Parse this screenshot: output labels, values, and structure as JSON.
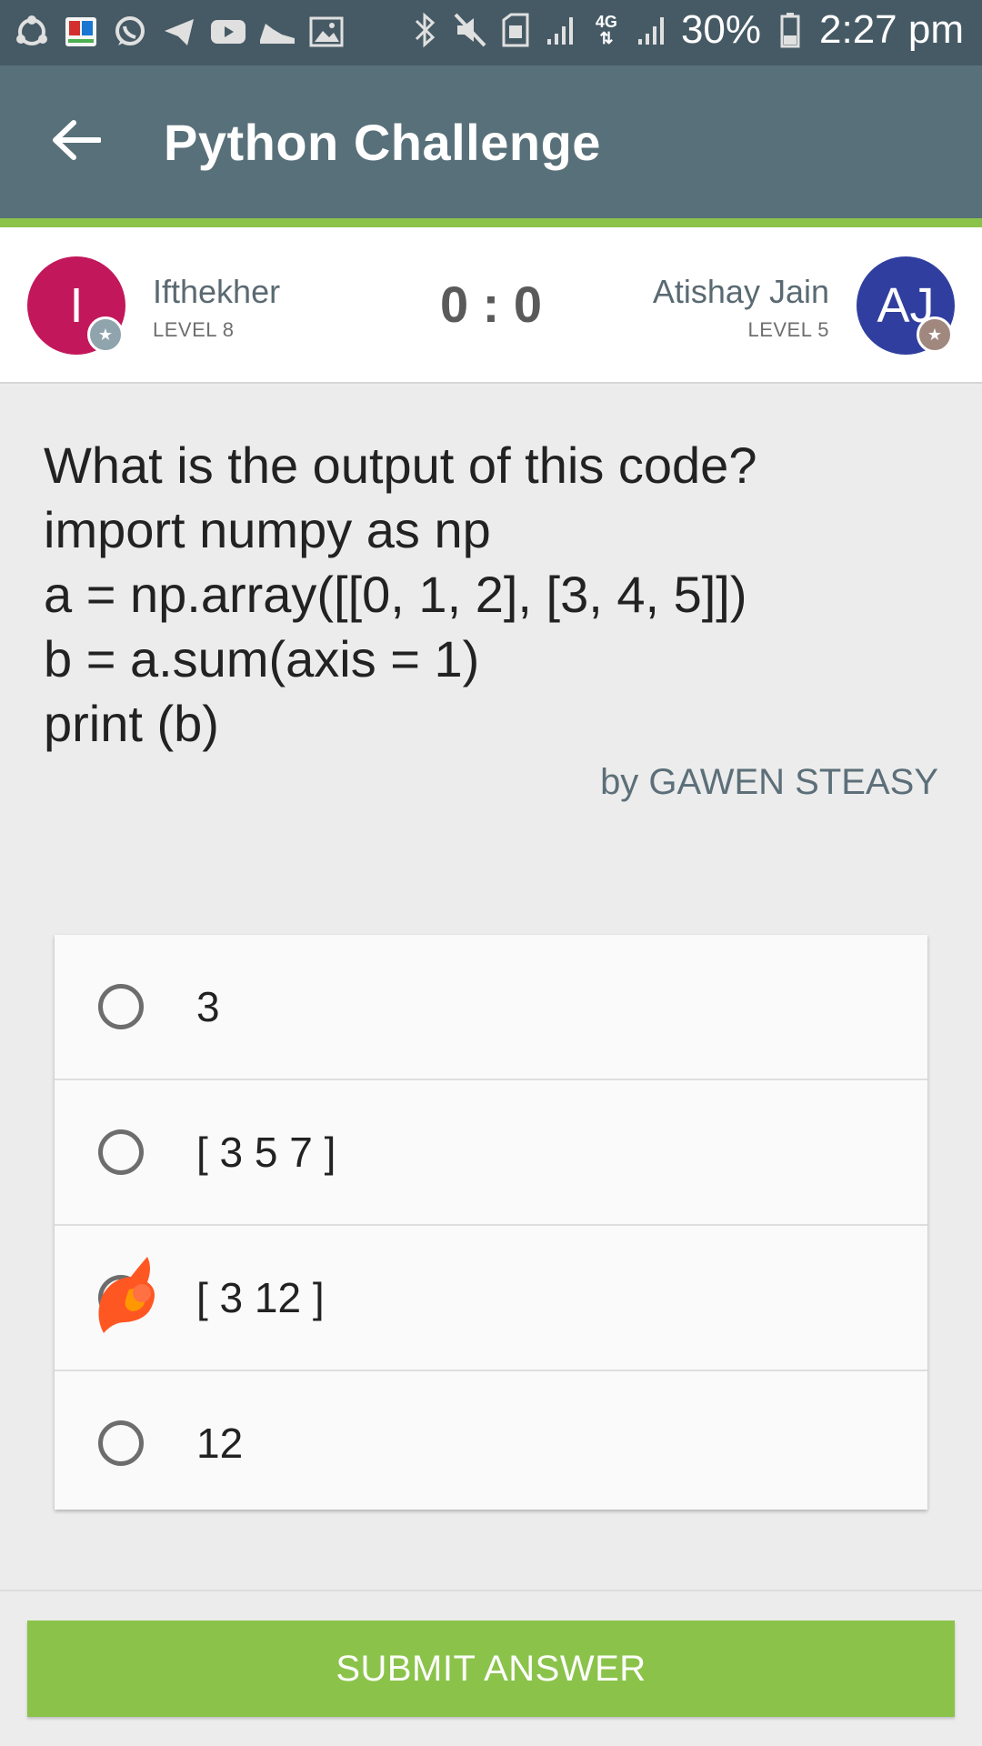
{
  "status_bar": {
    "battery": "30%",
    "time": "2:27 pm",
    "network": "4G",
    "left_icons": [
      "shareit-icon",
      "book-app-icon",
      "whatsapp-icon",
      "telegram-icon",
      "youtube-icon",
      "sneaker-icon",
      "gallery-icon"
    ],
    "right_icons": [
      "bluetooth-icon",
      "mute-icon",
      "sim-icon",
      "signal-icon",
      "4g-icon",
      "signal-icon",
      "battery-icon"
    ]
  },
  "app_bar": {
    "title": "Python Challenge",
    "back_icon": "arrow-left-icon"
  },
  "progress": {
    "value": 1.0,
    "color": "#8bc34a"
  },
  "players": {
    "left": {
      "initials": "I",
      "name": "Ifthekher",
      "level": "LEVEL 8",
      "color": "#c2185b"
    },
    "right": {
      "initials": "AJ",
      "name": "Atishay Jain",
      "level": "LEVEL 5",
      "color": "#303f9f"
    },
    "score": "0 : 0"
  },
  "question": {
    "text": "What is the output of this code?\nimport numpy as np\na = np.array([[0, 1, 2], [3, 4, 5]])\nb = a.sum(axis = 1)\nprint (b)",
    "author": "by GAWEN STEASY"
  },
  "options": [
    {
      "label": "3",
      "selected": false
    },
    {
      "label": "[ 3 5 7 ]",
      "selected": false
    },
    {
      "label": "[ 3 12 ]",
      "selected": true
    },
    {
      "label": "12",
      "selected": false
    }
  ],
  "submit_label": "SUBMIT ANSWER",
  "colors": {
    "status_bar": "#465a65",
    "app_bar": "#587079",
    "accent": "#8bc34a"
  }
}
